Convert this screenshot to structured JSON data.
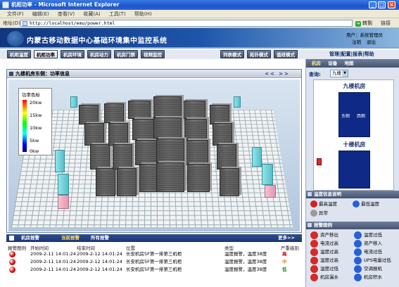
{
  "browser": {
    "title": "机柜功率 - Microsoft Internet Explorer",
    "menu": [
      "文件(F)",
      "编辑(E)",
      "查看(V)",
      "收藏(A)",
      "工具(T)",
      "帮助(H)"
    ],
    "address_label": "地址(D)",
    "url": "http://localhost/emu/power.html",
    "go_label": "转到",
    "links_label": "链接"
  },
  "header": {
    "title": "内蒙古移动数据中心基础环境集中监控系统",
    "user": "用户：系统管理员",
    "logout": "注销",
    "exit": "退出"
  },
  "tabs": [
    "机柜温度",
    "机柜功率",
    "机房环境",
    "机房动力",
    "机房门禁",
    "视频监控"
  ],
  "active_tab": 1,
  "view_modes": [
    "列表模式",
    "拓扑模式",
    "值班模式"
  ],
  "top_links": "管理|配置|报表|帮助",
  "panel": {
    "title": "九楼机房东侧：功率信息",
    "nav": "<< >>"
  },
  "legend": {
    "title": "功率色标",
    "labels": [
      "20kw",
      "15kw",
      "10kw",
      "5kw",
      "0kw"
    ]
  },
  "right_tabs": [
    "机房",
    "设备",
    "地图"
  ],
  "query_label": "查询:",
  "floor_value": "九楼",
  "map": {
    "top_title": "九楼机房",
    "east": "东侧",
    "west": "西侧",
    "bottom_title": "十楼机房"
  },
  "temp_section": {
    "title": "温度信息说明",
    "items": [
      {
        "label": "最高温度",
        "color": "#d42020"
      },
      {
        "label": "最低温度",
        "color": "#2a62d6"
      },
      {
        "label": "异常",
        "color": "#9a9a9a"
      }
    ]
  },
  "alarm_legend": {
    "title": "报警图例",
    "items": [
      {
        "label": "资产移出",
        "color": "#d42a2a"
      },
      {
        "label": "温度过低",
        "color": "#2a5fd6"
      },
      {
        "label": "电流过高",
        "color": "#d42a2a"
      },
      {
        "label": "资产移入",
        "color": "#2a5fd6"
      },
      {
        "label": "温度过高",
        "color": "#d42a2a"
      },
      {
        "label": "电流过低",
        "color": "#2a5fd6"
      },
      {
        "label": "湿度过高",
        "color": "#d42a2a"
      },
      {
        "label": "UPS电量过低",
        "color": "#2a5fd6"
      },
      {
        "label": "湿度过低",
        "color": "#d42a2a"
      },
      {
        "label": "空调报机",
        "color": "#2a5fd6"
      },
      {
        "label": "机房漏水",
        "color": "#d42a2a"
      },
      {
        "label": "机房积水",
        "color": "#2a5fd6"
      }
    ]
  },
  "alarm_bar": {
    "title": "机房报警",
    "current": "当前报警",
    "all": "所有报警",
    "more": "更多>>"
  },
  "alarm_table": {
    "headers": [
      "报警图例",
      "开始时间",
      "结束时间",
      "位置",
      "类型",
      "严重级别"
    ],
    "rows": [
      {
        "start": "2009-2-11 14:01:24",
        "end": "2009-2-12 14:01:24",
        "location": "长安机房5F第一排第三机柜",
        "type": "温度报警，温度38度",
        "severity": "高",
        "sev_color": "#d00000"
      },
      {
        "start": "2009-2-11 14:01:24",
        "end": "2009-2-12 14:01:24",
        "location": "长安机房5F第一排第三机柜",
        "type": "温度报警，温度38度",
        "severity": "中",
        "sev_color": "#e08a00"
      },
      {
        "start": "2009-2-11 14:01:24",
        "end": "2009-2-12 14:01:24",
        "location": "长安机房5F第一排第三机柜",
        "type": "温度报警，温度38度",
        "severity": "低",
        "sev_color": "#1c8a1c"
      }
    ]
  }
}
